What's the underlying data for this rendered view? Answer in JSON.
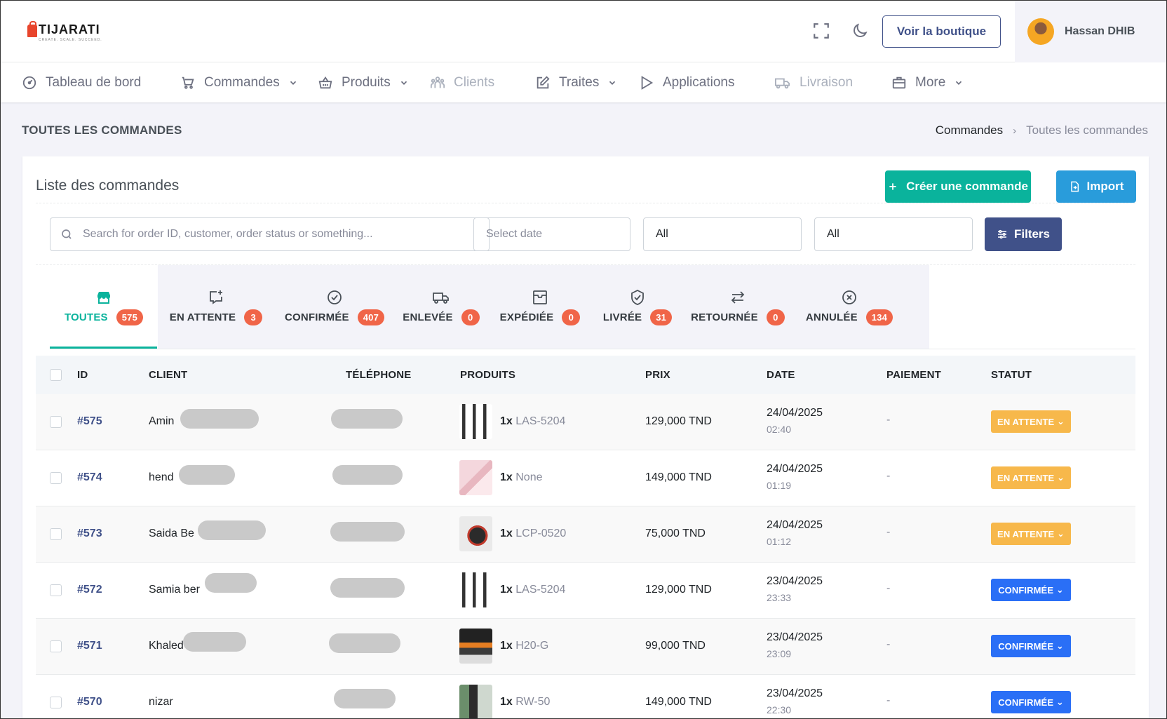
{
  "header": {
    "logo_text": "TIJARATI",
    "logo_tagline": "CREATE. SCALE. SUCCEED.",
    "shop_button": "Voir la boutique",
    "user_name": "Hassan DHIB"
  },
  "nav": [
    {
      "label": "Tableau de bord",
      "icon": "dashboard-icon"
    },
    {
      "label": "Commandes",
      "icon": "cart-icon"
    },
    {
      "label": "Produits",
      "icon": "basket-icon"
    },
    {
      "label": "Clients",
      "icon": "users-icon"
    },
    {
      "label": "Traites",
      "icon": "edit-icon"
    },
    {
      "label": "Applications",
      "icon": "play-icon"
    },
    {
      "label": "Livraison",
      "icon": "truck-icon"
    },
    {
      "label": "More",
      "icon": "briefcase-icon"
    }
  ],
  "page": {
    "title": "TOUTES LES COMMANDES",
    "breadcrumb": [
      "Commandes",
      "Toutes les commandes"
    ]
  },
  "card": {
    "title": "Liste des commandes",
    "create_button": "Créer une commande",
    "import_button": "Import",
    "search_placeholder": "Search for order ID, customer, order status or something...",
    "date_placeholder": "Select date",
    "select1_value": "All",
    "select2_value": "All",
    "filters_button": "Filters"
  },
  "tabs": [
    {
      "label": "TOUTES",
      "count": "575"
    },
    {
      "label": "EN ATTENTE",
      "count": "3"
    },
    {
      "label": "CONFIRMÉE",
      "count": "407"
    },
    {
      "label": "ENLEVÉE",
      "count": "0"
    },
    {
      "label": "EXPÉDIÉE",
      "count": "0"
    },
    {
      "label": "LIVRÉE",
      "count": "31"
    },
    {
      "label": "RETOURNÉE",
      "count": "0"
    },
    {
      "label": "ANNULÉE",
      "count": "134"
    }
  ],
  "table": {
    "headers": [
      "ID",
      "CLIENT",
      "TÉLÉPHONE",
      "PRODUITS",
      "PRIX",
      "DATE",
      "PAIEMENT",
      "STATUT"
    ],
    "rows": [
      {
        "id": "#575",
        "client": "Amin",
        "qty": "1x",
        "sku": "LAS-5204",
        "price": "129,000 TND",
        "date": "24/04/2025",
        "time": "02:40",
        "payment": "-",
        "status": "EN ATTENTE"
      },
      {
        "id": "#574",
        "client": "hend",
        "qty": "1x",
        "sku": "None",
        "price": "149,000 TND",
        "date": "24/04/2025",
        "time": "01:19",
        "payment": "-",
        "status": "EN ATTENTE"
      },
      {
        "id": "#573",
        "client": "Saida Be",
        "qty": "1x",
        "sku": "LCP-0520",
        "price": "75,000 TND",
        "date": "24/04/2025",
        "time": "01:12",
        "payment": "-",
        "status": "EN ATTENTE"
      },
      {
        "id": "#572",
        "client": "Samia ber",
        "qty": "1x",
        "sku": "LAS-5204",
        "price": "129,000 TND",
        "date": "23/04/2025",
        "time": "23:33",
        "payment": "-",
        "status": "CONFIRMÉE"
      },
      {
        "id": "#571",
        "client": "Khaled",
        "qty": "1x",
        "sku": "H20-G",
        "price": "99,000 TND",
        "date": "23/04/2025",
        "time": "23:09",
        "payment": "-",
        "status": "CONFIRMÉE"
      },
      {
        "id": "#570",
        "client": "nizar",
        "qty": "1x",
        "sku": "RW-50",
        "price": "149,000 TND",
        "date": "23/04/2025",
        "time": "22:30",
        "payment": "-",
        "status": "CONFIRMÉE"
      }
    ]
  },
  "colors": {
    "primary": "#405189",
    "success": "#0ab39c",
    "info": "#299cdb",
    "danger": "#f06548",
    "warning": "#f7b84b",
    "confirmed": "#2a6ff6"
  }
}
